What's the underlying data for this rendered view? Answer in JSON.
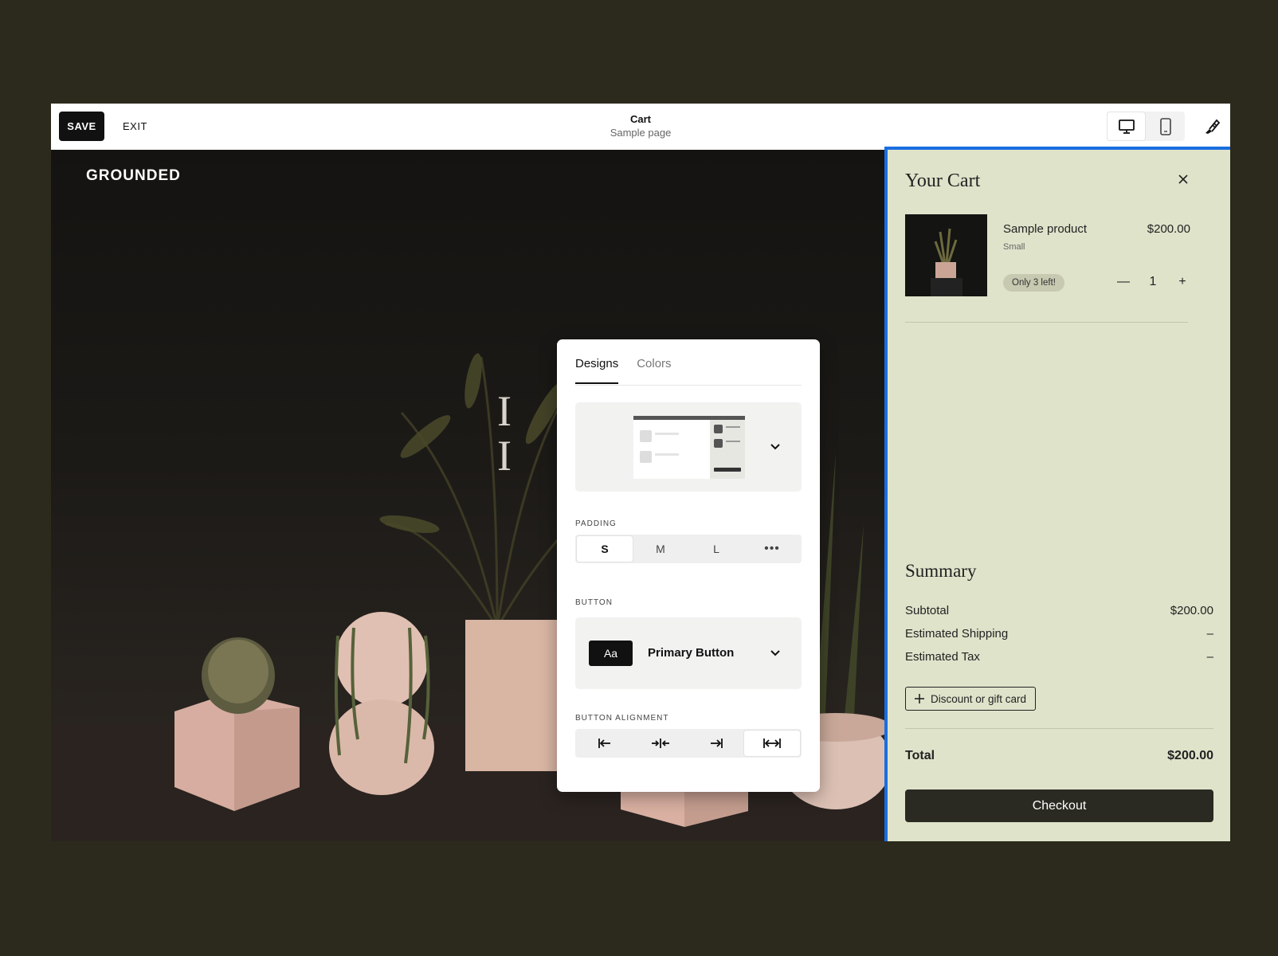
{
  "topbar": {
    "save_label": "SAVE",
    "exit_label": "EXIT",
    "page_title": "Cart",
    "page_subtitle": "Sample page",
    "icons": [
      "desktop-icon",
      "mobile-icon",
      "paintbrush-icon"
    ]
  },
  "site": {
    "logo": "GROUNDED",
    "hero_text": "I                s\nI                  e"
  },
  "design_panel": {
    "tabs": [
      {
        "label": "Designs",
        "active": true
      },
      {
        "label": "Colors",
        "active": false
      }
    ],
    "padding": {
      "label": "PADDING",
      "options": [
        "S",
        "M",
        "L",
        "•••"
      ],
      "selected": "S"
    },
    "button": {
      "label": "BUTTON",
      "chip": "Aa",
      "style": "Primary Button"
    },
    "alignment": {
      "label": "BUTTON ALIGNMENT",
      "options": [
        "align-left-icon",
        "align-center-icon",
        "align-right-icon",
        "align-full-width-icon"
      ],
      "selected": "align-full-width-icon"
    }
  },
  "cart": {
    "title": "Your Cart",
    "item": {
      "name": "Sample product",
      "variant": "Small",
      "price": "$200.00",
      "stock_badge": "Only 3 left!",
      "quantity": "1"
    },
    "summary": {
      "title": "Summary",
      "subtotal_label": "Subtotal",
      "subtotal_value": "$200.00",
      "shipping_label": "Estimated Shipping",
      "shipping_value": "–",
      "tax_label": "Estimated Tax",
      "tax_value": "–",
      "discount_label": "Discount or gift card",
      "total_label": "Total",
      "total_value": "$200.00"
    },
    "checkout_label": "Checkout"
  },
  "colors": {
    "outer_bg": "#2b2a1c",
    "cart_bg": "#dfe3ca",
    "selection_blue": "#1a6ee0",
    "checkout_bg": "#2a2a22"
  }
}
